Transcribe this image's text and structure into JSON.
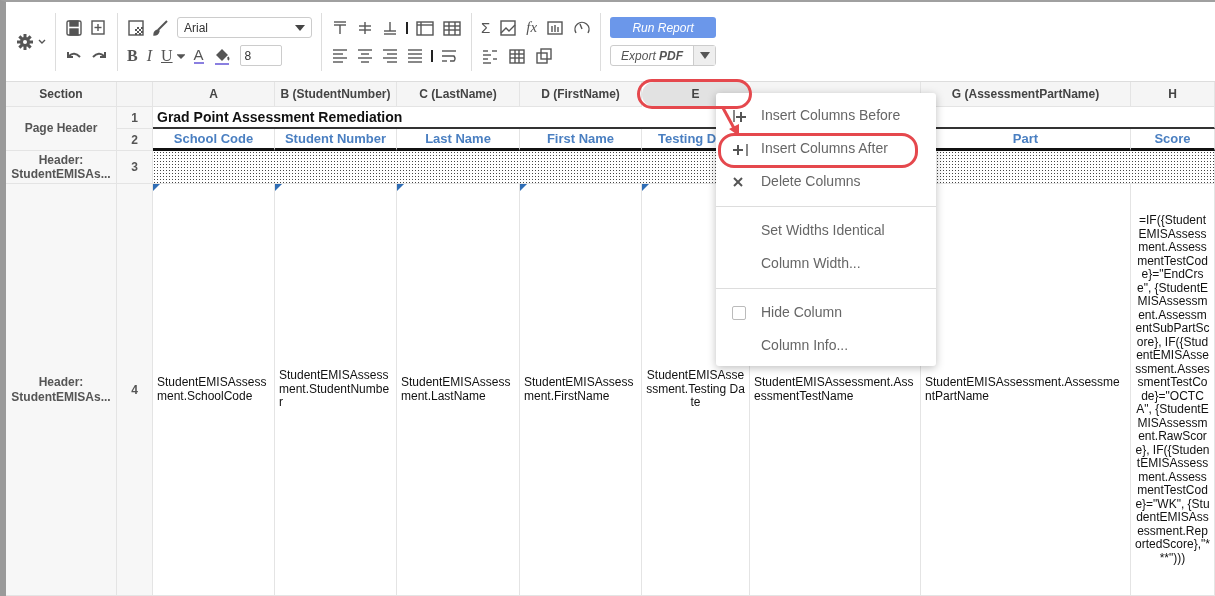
{
  "toolbar": {
    "font": "Arial",
    "font_size": "8",
    "format_buttons": [
      "B",
      "I",
      "U",
      "A"
    ],
    "formula_buttons": [
      "Σ",
      "fx"
    ],
    "run_button": "Run Report",
    "export_button": "Export **PDF**"
  },
  "sheet": {
    "corner": "Section",
    "columns": [
      {
        "letter": "A",
        "selected": false,
        "heading": "School Code",
        "field": "StudentEMISAssessment.SchoolCode",
        "flagged": true,
        "centered": false
      },
      {
        "letter": "B (StudentNumber)",
        "selected": false,
        "heading": "Student Number",
        "field": "StudentEMISAssessment.StudentNumber",
        "flagged": true,
        "centered": false
      },
      {
        "letter": "C (LastName)",
        "selected": false,
        "heading": "Last Name",
        "field": "StudentEMISAssessment.LastName",
        "flagged": true,
        "centered": false
      },
      {
        "letter": "D (FirstName)",
        "selected": false,
        "heading": "First Name",
        "field": "StudentEMISAssessment.FirstName",
        "flagged": true,
        "centered": false
      },
      {
        "letter": "E",
        "selected": true,
        "annotated": true,
        "heading": "Testing D",
        "heading_cut": true,
        "field": "StudentEMISAssessment.Testing Date",
        "flagged": true,
        "centered": true
      },
      {
        "selected": false,
        "field": "StudentEMISAssessment.AssessmentTestName",
        "flagged": false,
        "centered": false
      },
      {
        "letter": "G (AssessmentPartName)",
        "selected": false,
        "heading": "Part",
        "field": "StudentEMISAssessment.AssessmentPartName",
        "flagged": false,
        "centered": false
      },
      {
        "letter": "H",
        "selected": false,
        "heading": "Score",
        "field": "=IF({StudentEMISAssessment.AssessmentTestCode}=\"EndCrse\", {StudentEMISAssessment.AssessmentSubPartScore}, IF({StudentEMISAssessment.AssessmentTestCode}=\"OCTCA\", {StudentEMISAssessment.RawScore}, IF({StudentEMISAssessment.AssessmentTestCode}=\"WK\", {StudentEMISAssessment.ReportedScore},\"***\")))",
        "flagged": false,
        "centered": true
      }
    ],
    "sections": [
      {
        "label": "Page Header",
        "rows": [
          "1",
          "2"
        ]
      },
      {
        "label": "Header: StudentEMISAs...",
        "rows": [
          "3"
        ]
      },
      {
        "label": "Header: StudentEMISAs...",
        "rows": [
          "4"
        ]
      }
    ],
    "title": "Grad Point Assessment Remediation"
  },
  "menu": {
    "items": [
      {
        "kind": "insert_before",
        "label": "Insert Columns Before"
      },
      {
        "kind": "insert_after",
        "label": "Insert Columns After",
        "annotated": true
      },
      {
        "kind": "delete",
        "label": "Delete Columns"
      },
      {
        "kind": "separator"
      },
      {
        "kind": "plain",
        "label": "Set Widths Identical"
      },
      {
        "kind": "plain",
        "label": "Column Width..."
      },
      {
        "kind": "separator"
      },
      {
        "kind": "checkbox",
        "label": "Hide Column",
        "checked": false
      },
      {
        "kind": "plain",
        "label": "Column Info..."
      }
    ]
  }
}
